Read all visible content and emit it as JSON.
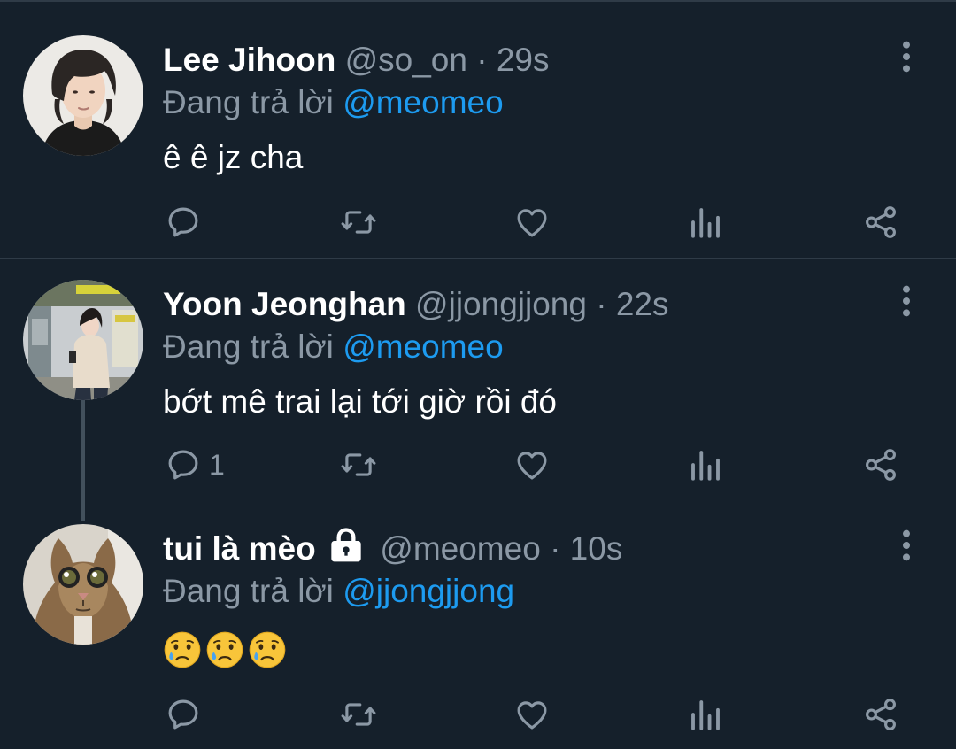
{
  "tweets": [
    {
      "name": "Lee Jihoon",
      "handle": "@so_on",
      "dot": "·",
      "time": "29s",
      "reply_prefix": "Đang trả lời",
      "reply_to": "@meomeo",
      "text": "ê ê jz cha",
      "reply_count": "",
      "icons": [
        "reply-icon",
        "retweet-icon",
        "like-icon",
        "stats-icon",
        "share-icon",
        "more-icon"
      ]
    },
    {
      "name": "Yoon Jeonghan",
      "handle": "@jjongjjong",
      "dot": "·",
      "time": "22s",
      "reply_prefix": "Đang trả lời",
      "reply_to": "@meomeo",
      "text": "bớt mê trai lại tới giờ rồi đó",
      "reply_count": "1",
      "icons": [
        "reply-icon",
        "retweet-icon",
        "like-icon",
        "stats-icon",
        "share-icon",
        "more-icon"
      ]
    },
    {
      "name": "tui là mèo",
      "locked": true,
      "handle": "@meomeo",
      "dot": "·",
      "time": "10s",
      "reply_prefix": "Đang trả lời",
      "reply_to": "@jjongjjong",
      "text_emojis": [
        "crying-face-emoji",
        "crying-face-emoji",
        "crying-face-emoji"
      ],
      "reply_count": "",
      "icons": [
        "reply-icon",
        "retweet-icon",
        "like-icon",
        "stats-icon",
        "share-icon",
        "more-icon",
        "lock-icon"
      ]
    }
  ],
  "colors": {
    "background": "#15202b",
    "text": "#ffffff",
    "secondary": "#8b98a5",
    "mention": "#1d9bf0",
    "divider": "#2f3b47"
  }
}
